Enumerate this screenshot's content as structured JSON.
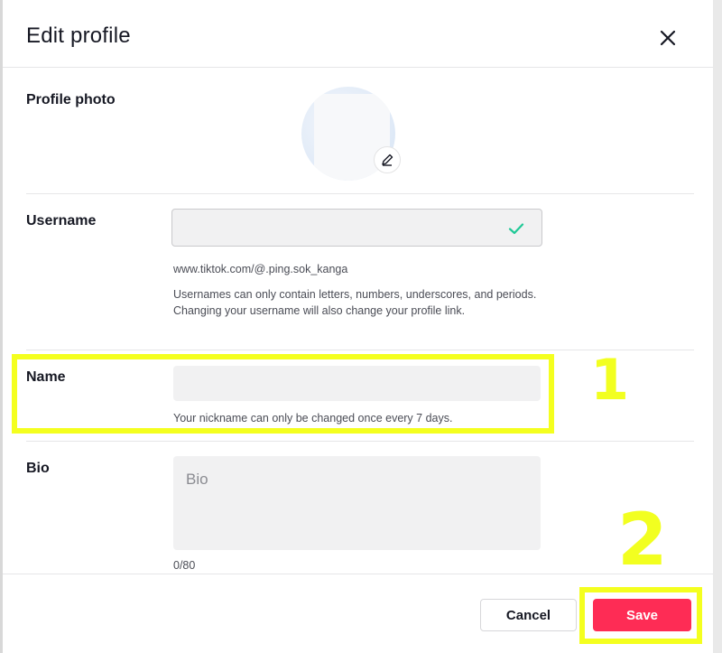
{
  "dialog": {
    "title": "Edit profile",
    "close_icon": "close-icon"
  },
  "profile_photo": {
    "label": "Profile photo",
    "edit_icon": "pencil-icon"
  },
  "username": {
    "label": "Username",
    "value": "",
    "status_icon": "checkmark-icon",
    "url": "www.tiktok.com/@.ping.sok_kanga",
    "helper": "Usernames can only contain letters, numbers, underscores, and periods. Changing your username will also change your profile link."
  },
  "name": {
    "label": "Name",
    "value": "",
    "helper": "Your nickname can only be changed once every 7 days."
  },
  "bio": {
    "label": "Bio",
    "placeholder": "Bio",
    "count": "0/80"
  },
  "footer": {
    "cancel_label": "Cancel",
    "save_label": "Save"
  },
  "annotations": {
    "step_1": "1",
    "step_2": "2",
    "highlight_color": "#f4ff1f"
  },
  "colors": {
    "accent": "#fe2c55",
    "check": "#20c997"
  }
}
